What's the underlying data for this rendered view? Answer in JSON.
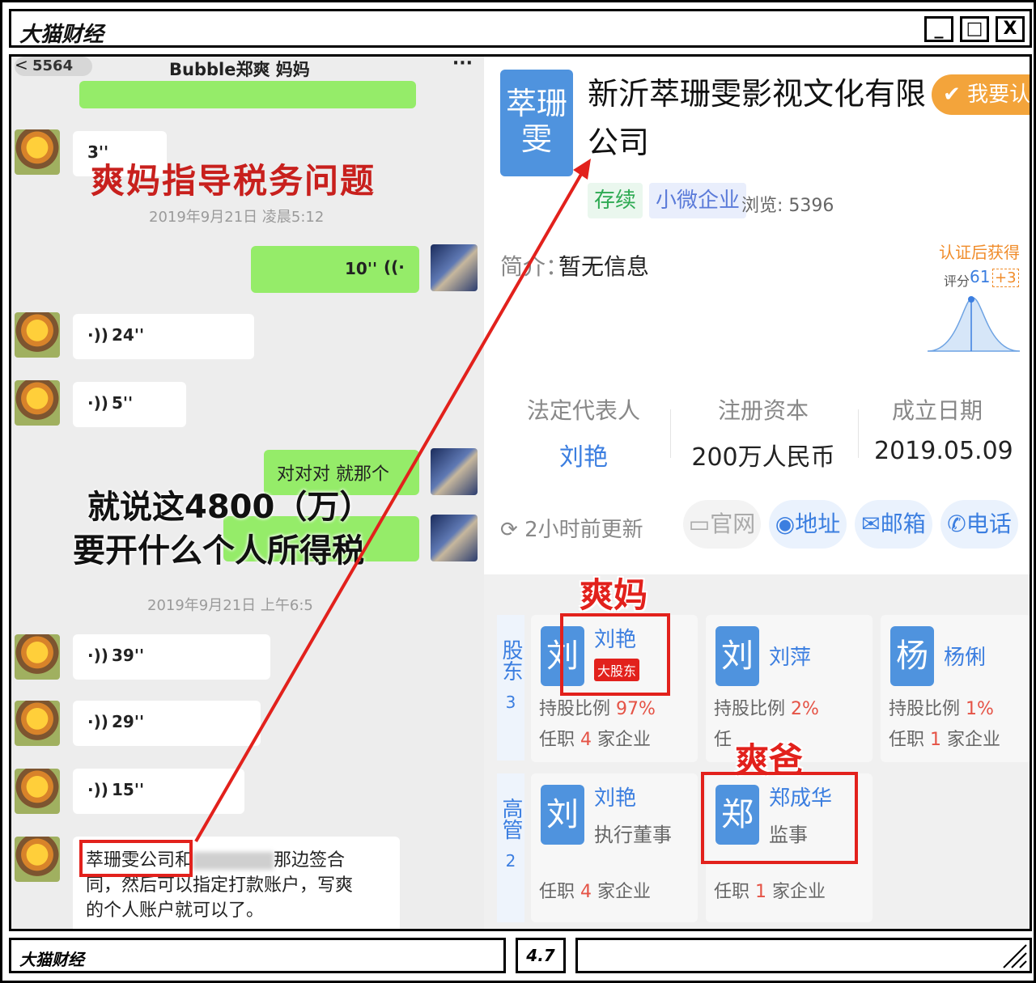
{
  "window": {
    "title": "大猫财经",
    "min": "_",
    "max": "□",
    "close": "X"
  },
  "chat": {
    "unread_count": "5564",
    "title": "Bubble郑爽 妈妈",
    "more": "···",
    "voice_1": "3''",
    "overlay_title": "爽妈指导税务问题",
    "timestamp_1": "2019年9月21日 凌晨5:12",
    "voice_2": "10''",
    "voice_3": "24''",
    "voice_4": "5''",
    "msg_agree": "对对对 就那个",
    "overlay_line1": "就说这4800（万）",
    "overlay_line2": "要开什么个人所得税",
    "timestamp_2": "2019年9月21日 上午6:5",
    "voice_5": "39''",
    "voice_6": "29''",
    "voice_7": "15''",
    "msg_company": "萃珊雯公司",
    "msg_and": "和",
    "msg_rest1": "那边签合",
    "msg_rest2": "同，然后可以指定打款账户，写爽",
    "msg_rest3": "的个人账户就可以了。"
  },
  "profile": {
    "logo_text": "萃珊雯",
    "company_name": "新沂萃珊雯影视文化有限公司",
    "verify_button": "我要认证",
    "tag_status": "存续",
    "tag_size": "小微企业",
    "views": "浏览: 5396",
    "intro_label": "简介：",
    "intro_value": "暂无信息",
    "cert_bonus_label": "认证后获得",
    "score_label": "评分",
    "score_value": "61",
    "score_plus": "+3",
    "legal_rep_label": "法定代表人",
    "legal_rep_value": "刘艳",
    "capital_label": "注册资本",
    "capital_value": "200万人民币",
    "founded_label": "成立日期",
    "founded_value": "2019.05.09",
    "updated": "2小时前更新",
    "btn_website": "官网",
    "btn_address": "地址",
    "btn_email": "邮箱",
    "btn_phone": "电话",
    "shareholders_label": "股东",
    "shareholders_count": "3",
    "managers_label": "高管",
    "managers_count": "2",
    "shareholders": [
      {
        "initial": "刘",
        "name": "刘艳",
        "badge": "大股东",
        "ratio_label": "持股比例",
        "ratio": "97%",
        "jobs_pre": "任职",
        "jobs": "4",
        "jobs_post": "家企业"
      },
      {
        "initial": "刘",
        "name": "刘萍",
        "ratio_label": "持股比例",
        "ratio": "2%",
        "jobs_pre": "任"
      },
      {
        "initial": "杨",
        "name": "杨俐",
        "ratio_label": "持股比例",
        "ratio": "1%",
        "jobs_pre": "任职",
        "jobs": "1",
        "jobs_post": "家企业"
      }
    ],
    "managers": [
      {
        "initial": "刘",
        "name": "刘艳",
        "role": "执行董事",
        "jobs_pre": "任职",
        "jobs": "4",
        "jobs_post": "家企业"
      },
      {
        "initial": "郑",
        "name": "郑成华",
        "role": "监事",
        "jobs_pre": "任职",
        "jobs": "1",
        "jobs_post": "家企业"
      }
    ],
    "annot_mom": "爽妈",
    "annot_dad": "爽爸"
  },
  "footer": {
    "left": "大猫财经",
    "rating": "4.7"
  }
}
